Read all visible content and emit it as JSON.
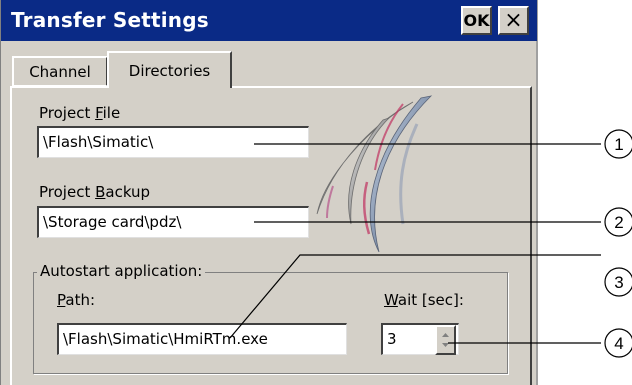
{
  "window": {
    "title": "Transfer Settings",
    "ok_label": "OK",
    "close_symbol": "×"
  },
  "tabs": [
    {
      "label": "Channel",
      "active": false
    },
    {
      "label": "Directories",
      "active": true
    }
  ],
  "project_file": {
    "label_pre": "Project ",
    "label_key": "F",
    "label_post": "ile",
    "value": "\\Flash\\Simatic\\"
  },
  "project_backup": {
    "label_pre": "Project ",
    "label_key": "B",
    "label_post": "ackup",
    "value": "\\Storage card\\pdz\\"
  },
  "autostart": {
    "group_title": "Autostart application:",
    "path_label_key": "P",
    "path_label_post": "ath:",
    "path_value": "\\Flash\\Simatic\\HmiRTm.exe",
    "wait_label_key": "W",
    "wait_label_post": "ait [sec]:",
    "wait_value": "3"
  },
  "callouts": [
    "1",
    "2",
    "3",
    "4"
  ],
  "colors": {
    "titlebar": "#0a2a86",
    "dialog_bg": "#d4d0c8"
  },
  "icons": {
    "logo": "simatic-logo-icon",
    "spin": "spin-arrow-icon"
  }
}
